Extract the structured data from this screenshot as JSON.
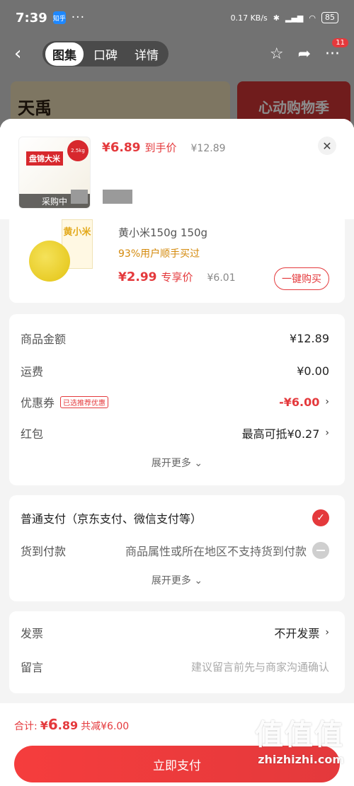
{
  "status_bar": {
    "time": "7:39",
    "app_badge": "知乎",
    "dots": "···",
    "network": "0.17 KB/s",
    "battery": "85"
  },
  "nav": {
    "tabs": [
      "图集",
      "口碑",
      "详情"
    ],
    "active_tab": 0,
    "more_badge": "11"
  },
  "background_banner": {
    "brand": "天禹",
    "promo": "心动购物季"
  },
  "sheet": {
    "product": {
      "thumb_tag": "盘锦大米",
      "thumb_circle": "2.5kg",
      "buying_label": "采购中",
      "price_currency": "¥",
      "price_int": "6",
      "price_dec": ".89",
      "price_label": "到手价",
      "original_price": "¥12.89"
    },
    "addon": {
      "pack_text": "黄小米",
      "title": "黄小米150g  150g",
      "bought": "93%用户顺手买过",
      "price_currency": "¥",
      "price_int": "2",
      "price_dec": ".99",
      "price_label": "专享价",
      "original_price": "¥6.01",
      "buy_button": "一键购买"
    },
    "summary": {
      "goods_label": "商品金额",
      "goods_value": "¥12.89",
      "shipping_label": "运费",
      "shipping_value": "¥0.00",
      "coupon_label": "优惠券",
      "coupon_tag": "已选推荐优惠",
      "coupon_value": "-¥6.00",
      "redpacket_label": "红包",
      "redpacket_value": "最高可抵¥0.27",
      "expand": "展开更多 ⌄"
    },
    "payment": {
      "normal_label": "普通支付（京东支付、微信支付等）",
      "cod_label": "货到付款",
      "cod_note": "商品属性或所在地区不支持货到付款",
      "expand": "展开更多 ⌄"
    },
    "extra": {
      "invoice_label": "发票",
      "invoice_value": "不开发票",
      "message_label": "留言",
      "message_placeholder": "建议留言前先与商家沟通确认"
    },
    "bottom": {
      "total_label": "合计:",
      "total_currency": "¥",
      "total_int": "6",
      "total_dec": ".89",
      "saved": "共减¥6.00",
      "pay_button": "立即支付"
    }
  },
  "watermark": {
    "logo": "值值值",
    "url": "zhizhizhi.com"
  },
  "colors": {
    "accent": "#e4393c",
    "price": "#e4393c",
    "bought": "#d48a0c"
  }
}
